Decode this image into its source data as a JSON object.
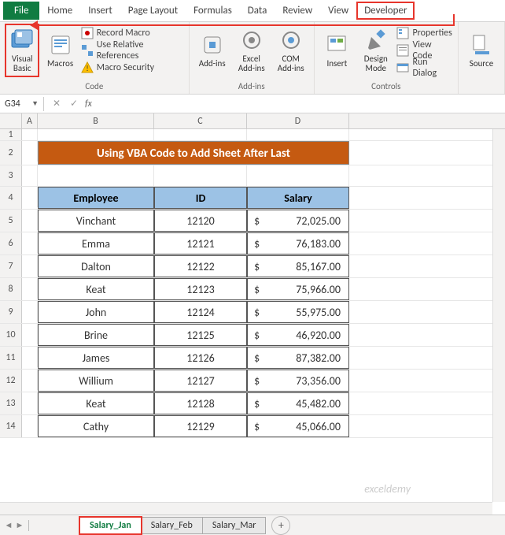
{
  "tabs": {
    "file": "File",
    "home": "Home",
    "insert": "Insert",
    "page_layout": "Page Layout",
    "formulas": "Formulas",
    "data": "Data",
    "review": "Review",
    "view": "View",
    "developer": "Developer"
  },
  "ribbon": {
    "code": {
      "visual_basic": "Visual Basic",
      "macros": "Macros",
      "record_macro": "Record Macro",
      "relative_refs": "Use Relative References",
      "macro_security": "Macro Security",
      "label": "Code"
    },
    "addins": {
      "addins": "Add-ins",
      "excel_addins": "Excel Add-ins",
      "com_addins": "COM Add-ins",
      "label": "Add-ins"
    },
    "controls": {
      "insert": "Insert",
      "design_mode": "Design Mode",
      "properties": "Properties",
      "view_code": "View Code",
      "run_dialog": "Run Dialog",
      "label": "Controls"
    },
    "xml": {
      "source": "Source"
    }
  },
  "name_box": "G34",
  "columns": [
    "A",
    "B",
    "C",
    "D"
  ],
  "banner": "Using VBA Code to Add Sheet After Last",
  "table": {
    "headers": {
      "emp": "Employee",
      "id": "ID",
      "sal": "Salary"
    },
    "rows": [
      {
        "n": 5,
        "emp": "Vinchant",
        "id": "12120",
        "sal": "72,025.00"
      },
      {
        "n": 6,
        "emp": "Emma",
        "id": "12121",
        "sal": "76,183.00"
      },
      {
        "n": 7,
        "emp": "Dalton",
        "id": "12122",
        "sal": "85,167.00"
      },
      {
        "n": 8,
        "emp": "Keat",
        "id": "12123",
        "sal": "75,966.00"
      },
      {
        "n": 9,
        "emp": "John",
        "id": "12124",
        "sal": "55,975.00"
      },
      {
        "n": 10,
        "emp": "Brine",
        "id": "12125",
        "sal": "46,920.00"
      },
      {
        "n": 11,
        "emp": "James",
        "id": "12126",
        "sal": "87,382.00"
      },
      {
        "n": 12,
        "emp": "Willium",
        "id": "12127",
        "sal": "73,356.00"
      },
      {
        "n": 13,
        "emp": "Keat",
        "id": "12128",
        "sal": "45,482.00"
      },
      {
        "n": 14,
        "emp": "Cathy",
        "id": "12129",
        "sal": "45,066.00"
      }
    ],
    "currency": "$"
  },
  "sheets": {
    "jan": "Salary_Jan",
    "feb": "Salary_Feb",
    "mar": "Salary_Mar"
  },
  "watermark": "exceldemy"
}
